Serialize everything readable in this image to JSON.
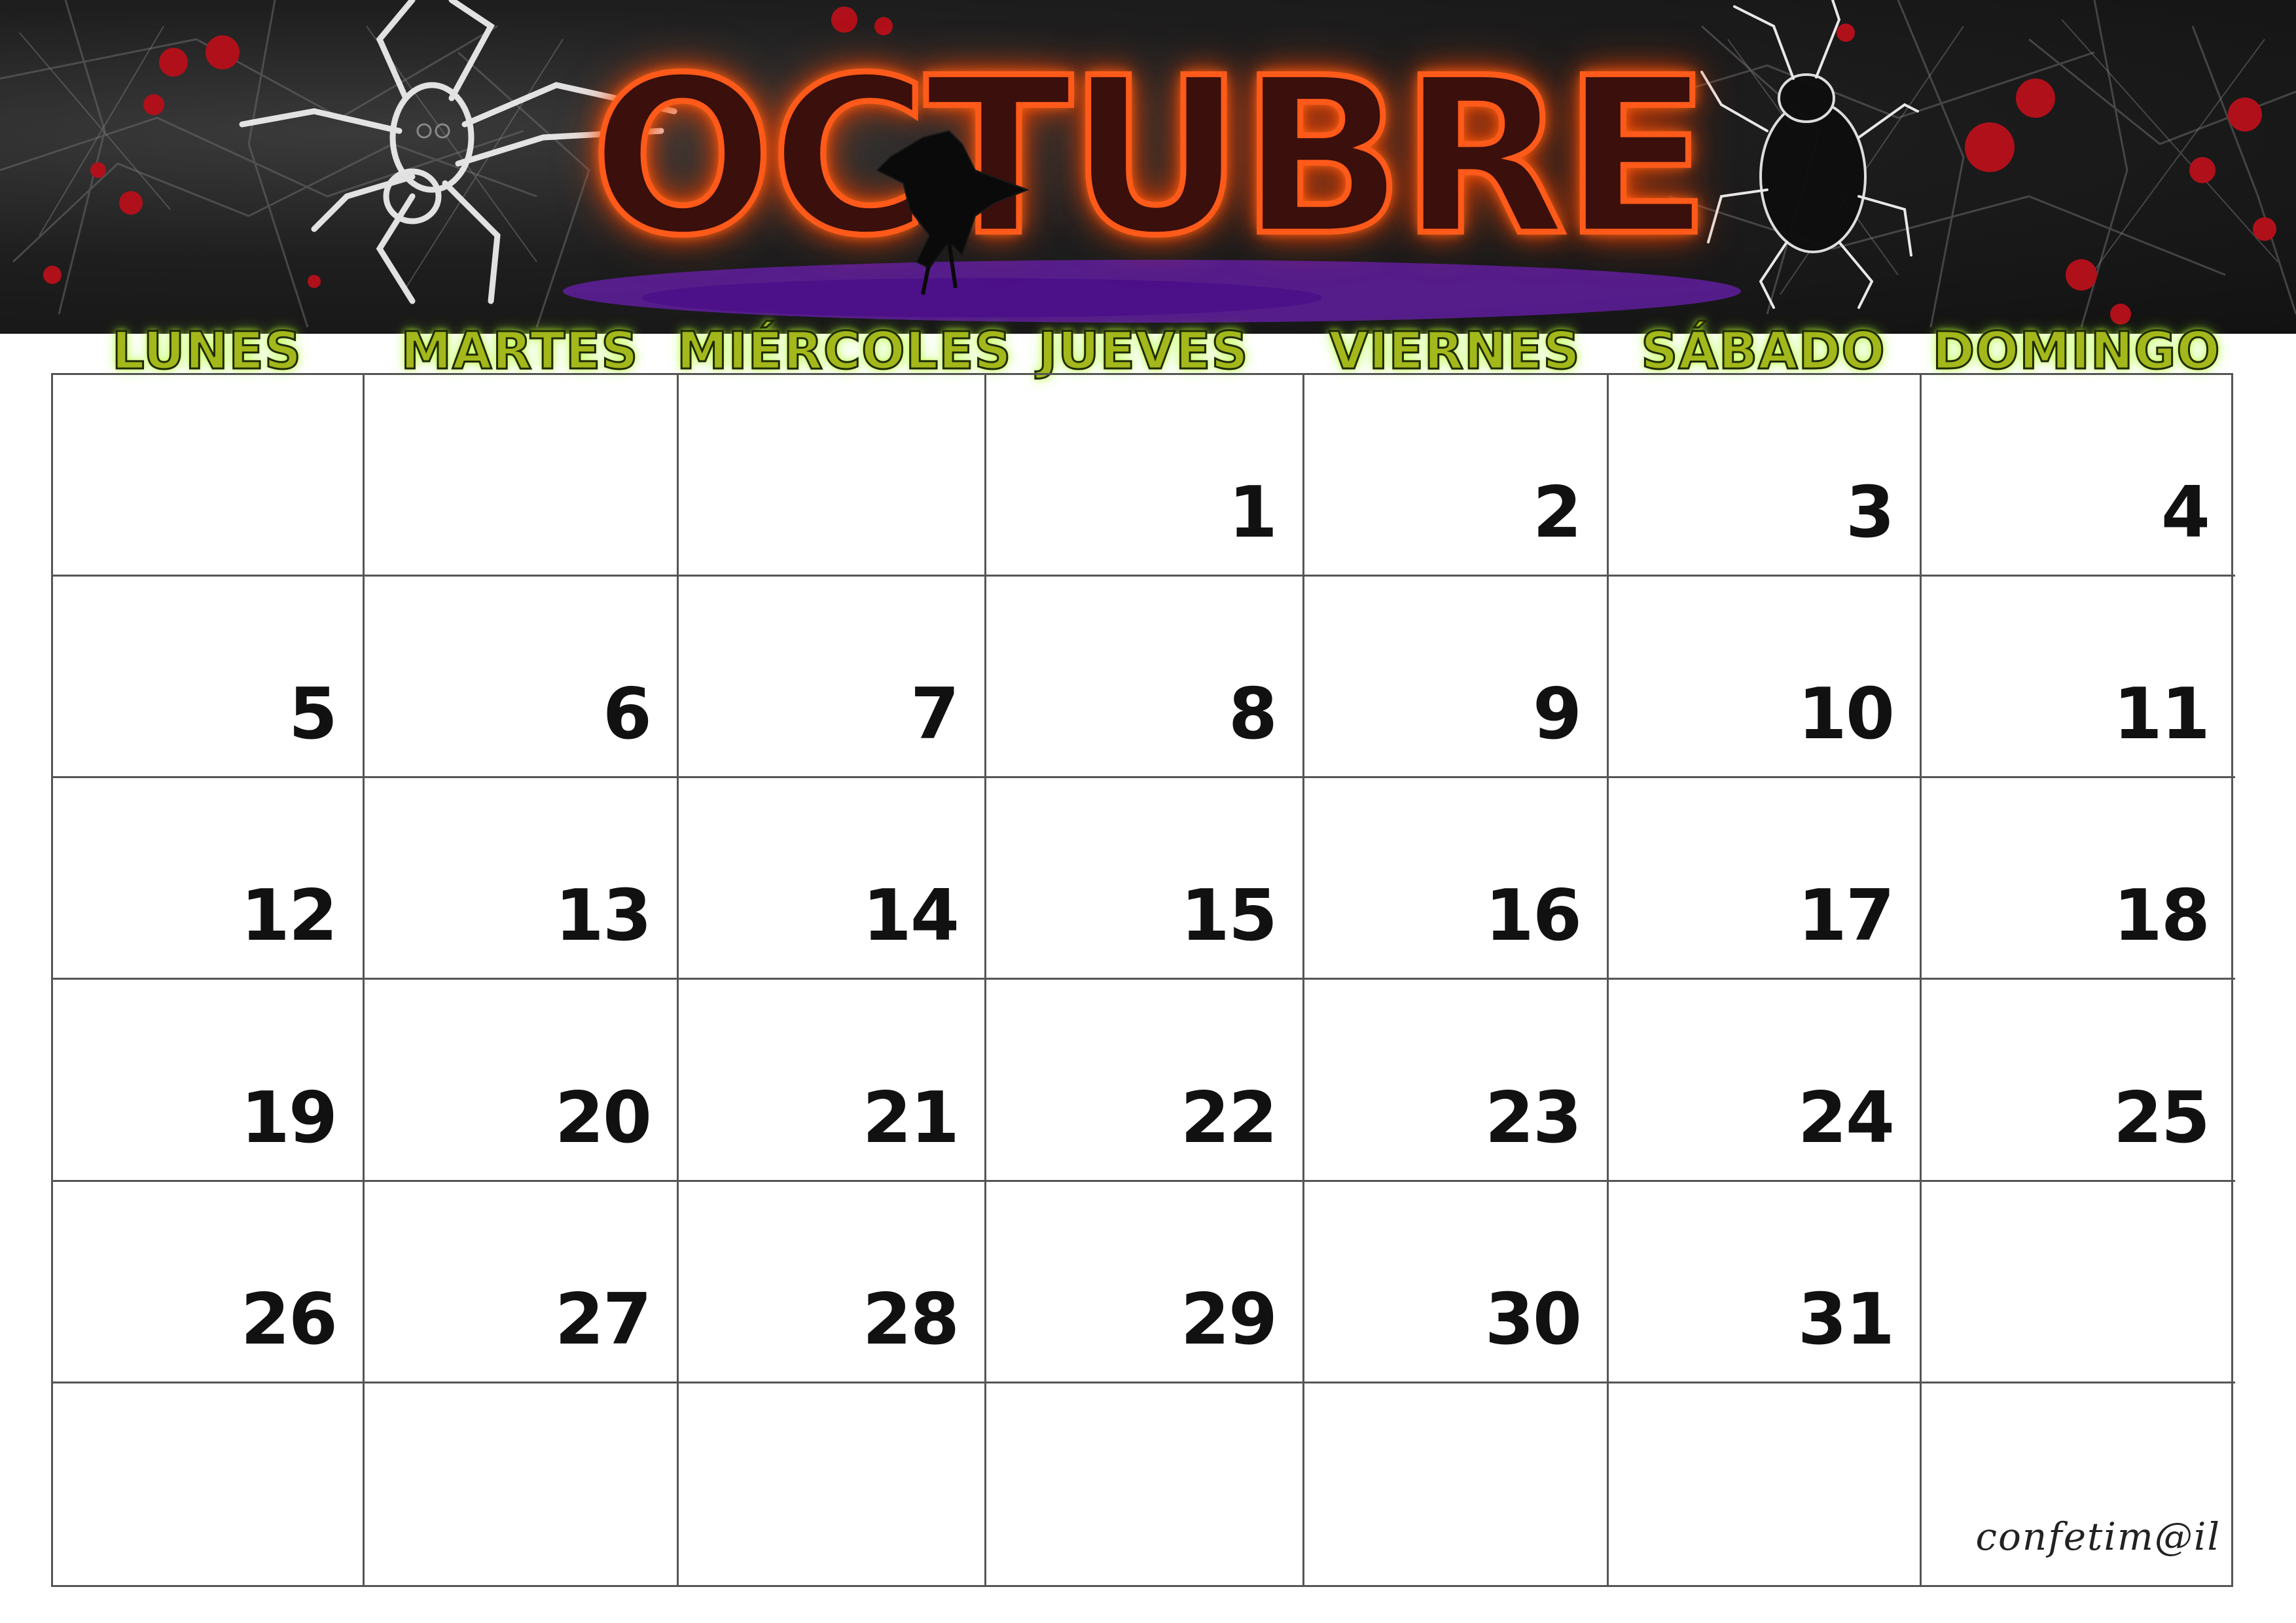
{
  "month": "OCTUBRE",
  "weekdays": [
    "LUNES",
    "MARTES",
    "MIÉRCOLES",
    "JUEVES",
    "VIERNES",
    "SÁBADO",
    "DOMINGO"
  ],
  "weeks": [
    [
      "",
      "",
      "",
      "1",
      "2",
      "3",
      "4"
    ],
    [
      "5",
      "6",
      "7",
      "8",
      "9",
      "10",
      "11"
    ],
    [
      "12",
      "13",
      "14",
      "15",
      "16",
      "17",
      "18"
    ],
    [
      "19",
      "20",
      "21",
      "22",
      "23",
      "24",
      "25"
    ],
    [
      "26",
      "27",
      "28",
      "29",
      "30",
      "31",
      ""
    ],
    [
      "",
      "",
      "",
      "",
      "",
      "",
      ""
    ]
  ],
  "signature": "confetim@il",
  "colors": {
    "banner_bg": "#1a1a1a",
    "title_fill": "#3b0f0b",
    "title_outline": "#ff5a1a",
    "weekday_text": "#a3b81a",
    "blood_red": "#b0101a",
    "purple_haze": "#6a1fb0",
    "grid_line": "#555555"
  },
  "decorations": {
    "left_creature_icon": "spider-icon",
    "right_creature_icon": "beetle-icon",
    "title_creature_icon": "crow-icon"
  }
}
